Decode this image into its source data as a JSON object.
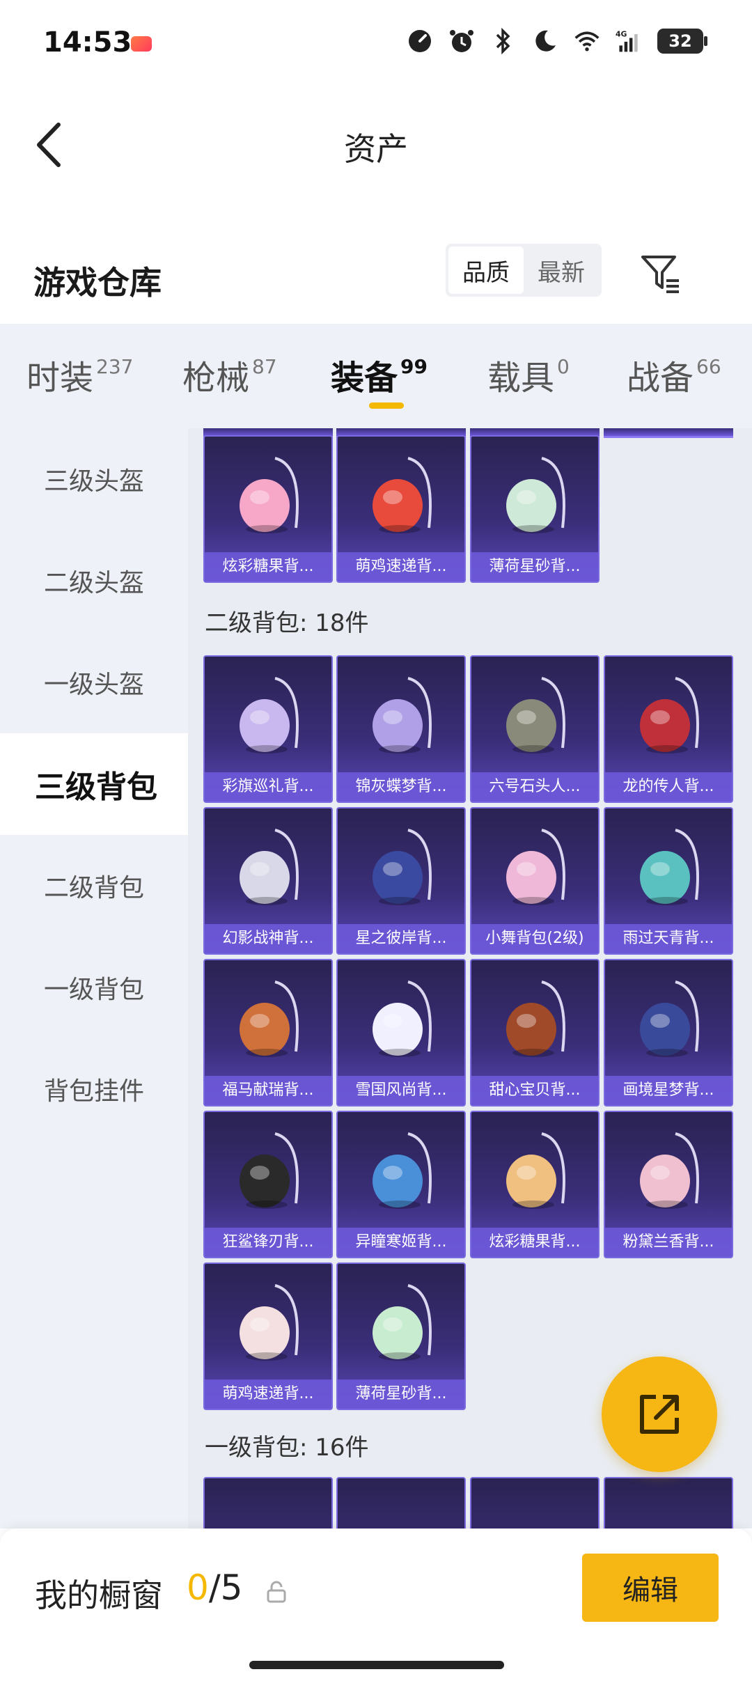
{
  "status_bar": {
    "time": "14:53",
    "battery": "32",
    "icons": [
      "game-icon",
      "speedometer-icon",
      "alarm-icon",
      "bluetooth-icon",
      "moon-icon",
      "wifi-icon",
      "signal-4g-icon",
      "battery-icon"
    ]
  },
  "header": {
    "title": "资产",
    "back_icon": "chevron-left-icon"
  },
  "warehouse": {
    "title": "游戏仓库",
    "sort_options": [
      "品质",
      "最新"
    ],
    "sort_selected": "品质",
    "filter_icon": "filter-icon"
  },
  "tabs": [
    {
      "label": "时装",
      "count": "237"
    },
    {
      "label": "枪械",
      "count": "87"
    },
    {
      "label": "装备",
      "count": "99",
      "active": true
    },
    {
      "label": "载具",
      "count": "0"
    },
    {
      "label": "战备",
      "count": "66"
    }
  ],
  "sidebar": {
    "items": [
      "三级头盔",
      "二级头盔",
      "一级头盔",
      "三级背包",
      "二级背包",
      "一级背包",
      "背包挂件"
    ],
    "active": "三级背包"
  },
  "content": {
    "top_group_items": [
      "炫彩糖果背...",
      "萌鸡速递背...",
      "薄荷星砂背..."
    ],
    "section_2": {
      "title": "二级背包: 18件",
      "items": [
        "彩旗巡礼背...",
        "锦灰蝶梦背...",
        "六号石头人...",
        "龙的传人背...",
        "幻影战神背...",
        "星之彼岸背...",
        "小舞背包(2级)",
        "雨过天青背...",
        "福马献瑞背...",
        "雪国风尚背...",
        "甜心宝贝背...",
        "画境星梦背...",
        "狂鲨锋刃背...",
        "异瞳寒姬背...",
        "炫彩糖果背...",
        "粉黛兰香背...",
        "萌鸡速递背...",
        "薄荷星砂背..."
      ]
    },
    "section_3": {
      "title": "一级背包: 16件"
    }
  },
  "fab": {
    "icon": "share-external-icon"
  },
  "bottom_bar": {
    "label": "我的橱窗",
    "count_current": "0",
    "count_total": "/5",
    "lock_icon": "lock-icon",
    "edit_label": "编辑"
  },
  "colors": {
    "accent": "#f6b614",
    "item_bg": "#3b2e7a",
    "item_label": "#6e5adc"
  }
}
